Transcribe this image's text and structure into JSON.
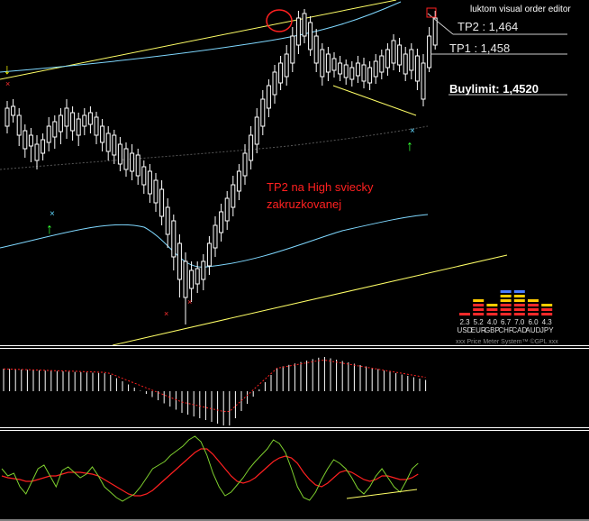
{
  "editor": {
    "title": "luktom visual order editor"
  },
  "orders": {
    "tp2": "TP2 : 1,464",
    "tp1": "TP1 : 1,458",
    "buylimit": "Buylimit: 1,4520"
  },
  "annotation": {
    "line1": "TP2 na High sviecky",
    "line2": "zakruzkovanej"
  },
  "price_meter": {
    "footer": "xxx Price Meter System™ ©GPL xxx",
    "items": [
      {
        "value": "2.3",
        "currency": "USD",
        "red": 1,
        "yellow": 0,
        "blue": 0
      },
      {
        "value": "5.2",
        "currency": "EUR",
        "red": 3,
        "yellow": 1,
        "blue": 0
      },
      {
        "value": "4.0",
        "currency": "GBP",
        "red": 2,
        "yellow": 1,
        "blue": 0
      },
      {
        "value": "6.7",
        "currency": "CHF",
        "red": 3,
        "yellow": 2,
        "blue": 1
      },
      {
        "value": "7.0",
        "currency": "CAD",
        "red": 3,
        "yellow": 2,
        "blue": 1
      },
      {
        "value": "6.0",
        "currency": "AUD",
        "red": 3,
        "yellow": 1,
        "blue": 0
      },
      {
        "value": "4.3",
        "currency": "JPY",
        "red": 2,
        "yellow": 1,
        "blue": 0
      }
    ]
  },
  "colors": {
    "background": "#000000",
    "candle": "#ffffff",
    "trendline": "#ffff66",
    "ma": "#7fd8ff",
    "annotation": "#ff2020",
    "signal_arrow": "#33ff33",
    "signal_cross": "#5fd8ff",
    "stoch_main": "#7ecf2e",
    "stoch_signal": "#ff2020"
  }
}
